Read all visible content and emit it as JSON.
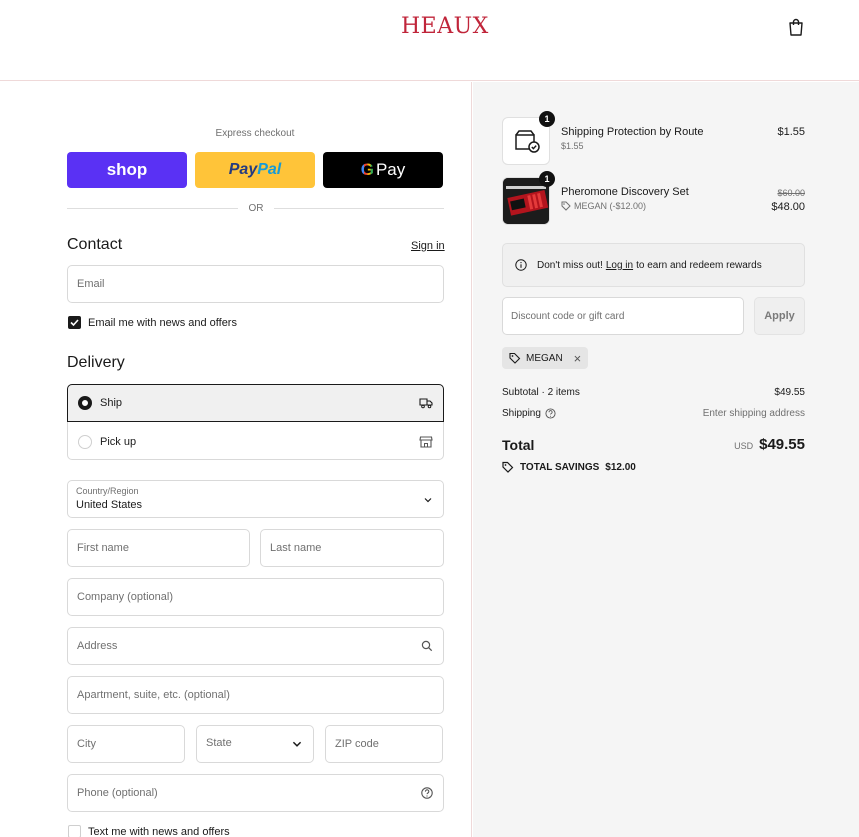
{
  "header": {
    "logo": "HEAUX",
    "cart_icon": "shopping-bag-icon"
  },
  "express": {
    "label": "Express checkout",
    "shop_label": "shop",
    "paypal_part1": "Pay",
    "paypal_part2": "Pal",
    "gpay_g": "G",
    "gpay_label": "Pay",
    "or_label": "OR"
  },
  "contact": {
    "title": "Contact",
    "signin": "Sign in",
    "email_placeholder": "Email",
    "newsletter_label": "Email me with news and offers",
    "newsletter_checked": true
  },
  "delivery": {
    "title": "Delivery",
    "options": [
      {
        "label": "Ship",
        "selected": true,
        "icon": "truck-icon"
      },
      {
        "label": "Pick up",
        "selected": false,
        "icon": "store-icon"
      }
    ],
    "country_label": "Country/Region",
    "country_value": "United States",
    "first_name": "First name",
    "last_name": "Last name",
    "company": "Company (optional)",
    "address": "Address",
    "apartment": "Apartment, suite, etc. (optional)",
    "city": "City",
    "state": "State",
    "zip": "ZIP code",
    "phone": "Phone (optional)",
    "sms_label": "Text me with news and offers"
  },
  "order": {
    "items": [
      {
        "name": "Shipping Protection by Route",
        "sub": "$1.55",
        "price": "$1.55",
        "qty": "1",
        "icon": "package-check-icon"
      },
      {
        "name": "Pheromone Discovery Set",
        "sub": "MEGAN (-$12.00)",
        "original_price": "$60.00",
        "price": "$48.00",
        "qty": "1"
      }
    ],
    "notice_pre": "Don't miss out!",
    "notice_link": "Log in",
    "notice_post": "to earn and redeem rewards",
    "discount_placeholder": "Discount code or gift card",
    "apply_label": "Apply",
    "applied_code": "MEGAN",
    "subtotal_label": "Subtotal · 2 items",
    "subtotal_value": "$49.55",
    "shipping_label": "Shipping",
    "shipping_value": "Enter shipping address",
    "total_label": "Total",
    "total_currency": "USD",
    "total_value": "$49.55",
    "savings_label": "TOTAL SAVINGS",
    "savings_value": "$12.00"
  },
  "colors": {
    "shop_purple": "#5a31f4",
    "paypal_yellow": "#ffc439",
    "logo_red": "#c0253a",
    "summary_bg": "#f5f5f5"
  }
}
